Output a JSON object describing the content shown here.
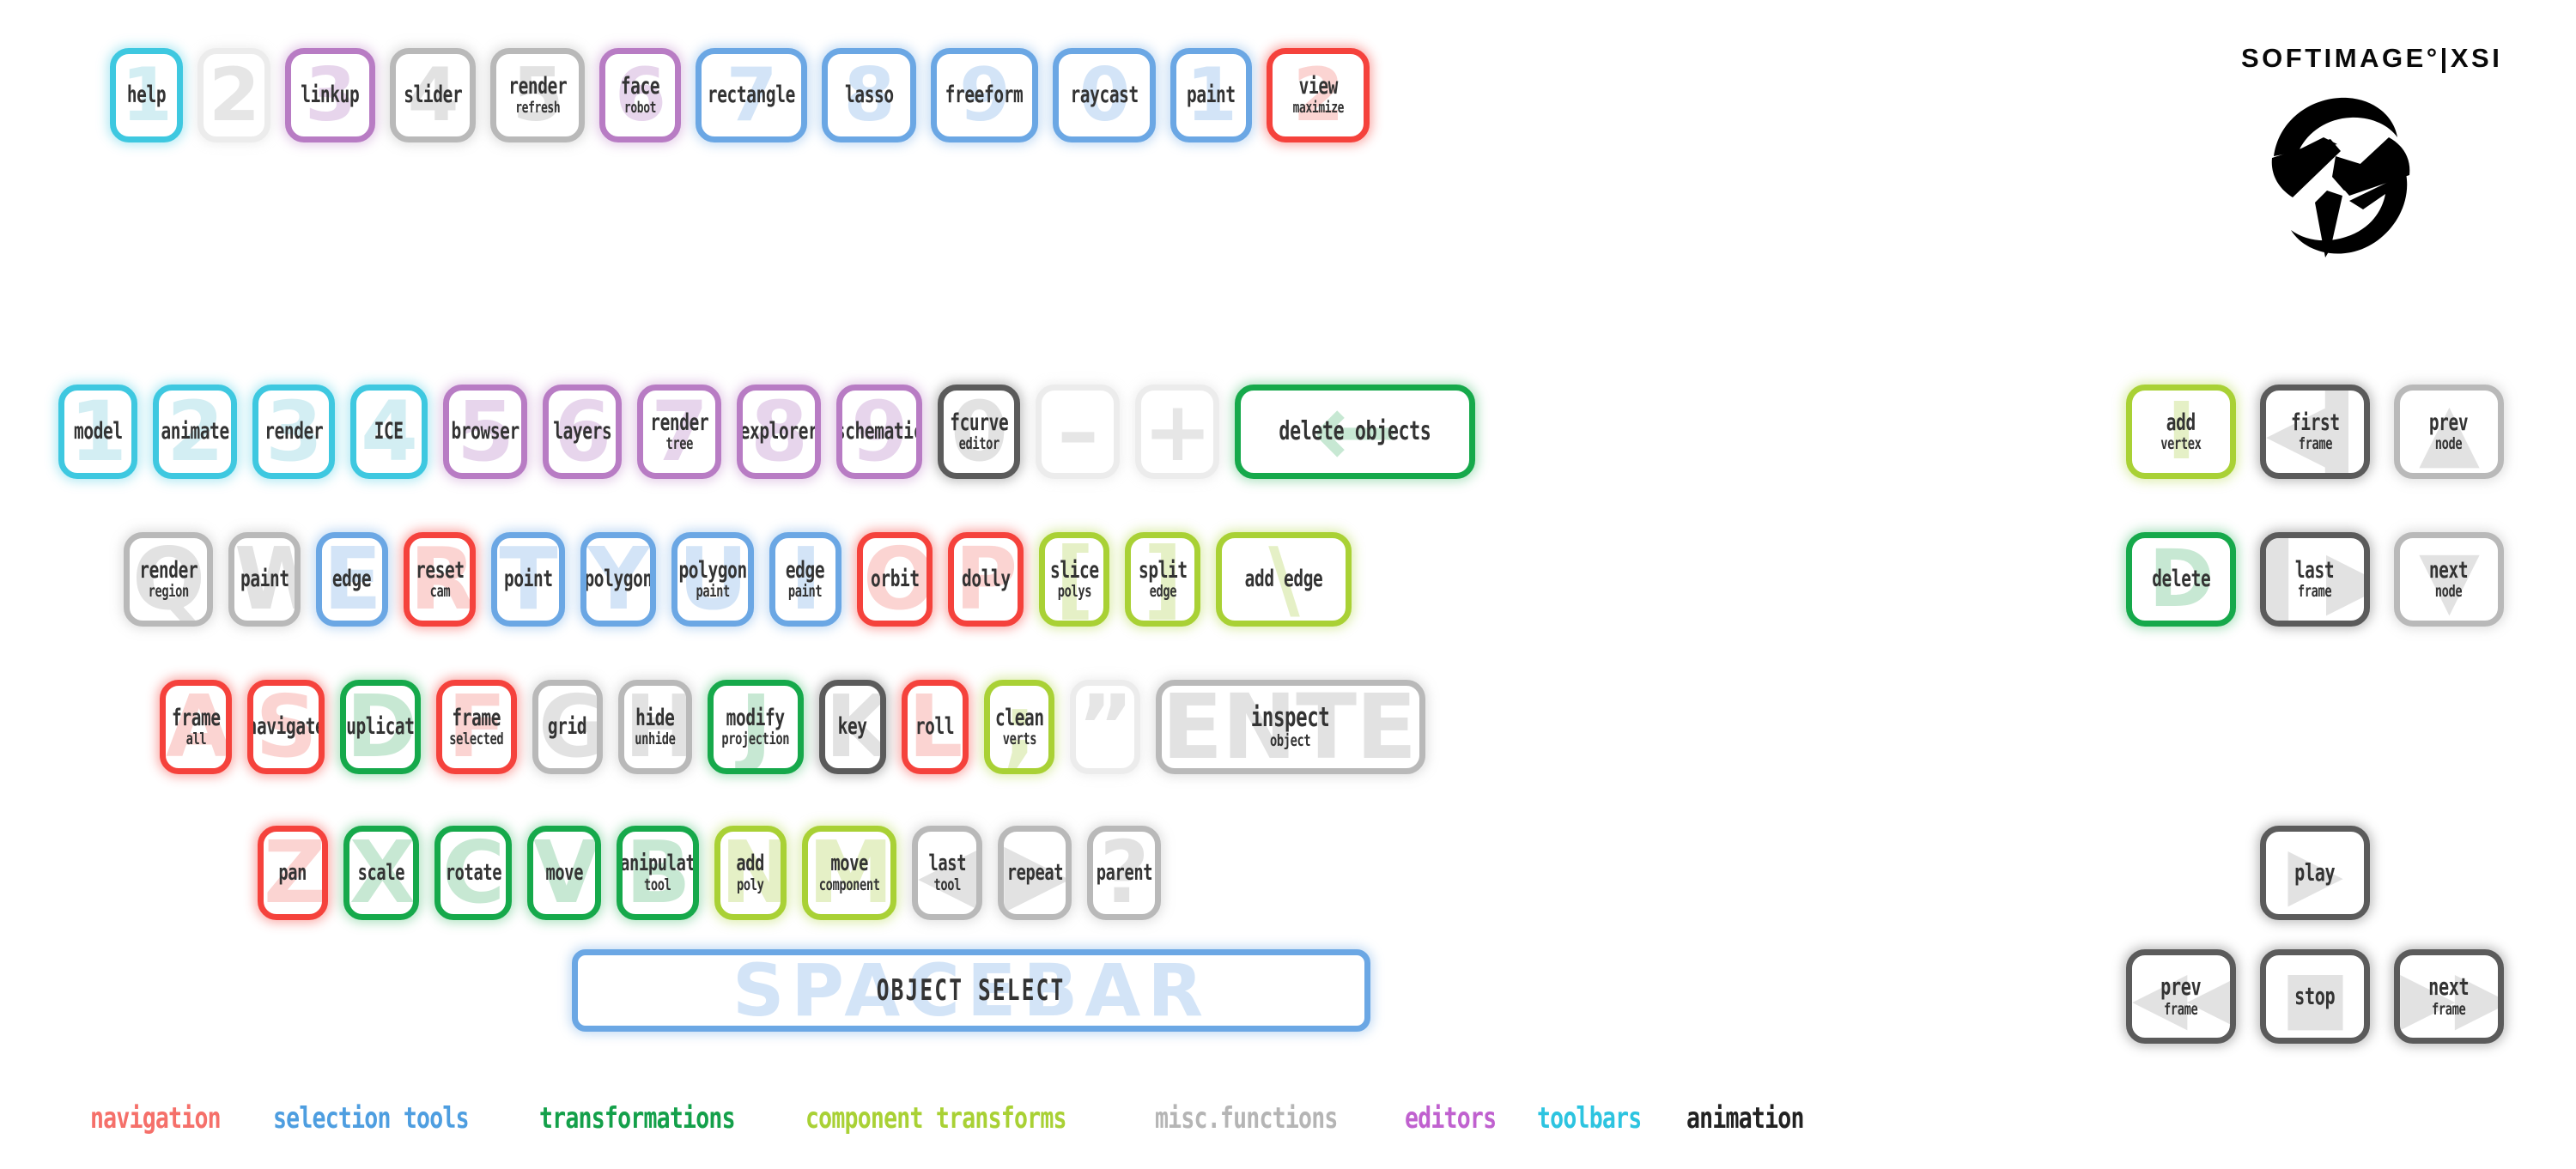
{
  "brand": {
    "wordmark": "SOFTIMAGE°|XSI",
    "mark_name": "softimage-swirl-logo"
  },
  "legend": {
    "items": [
      {
        "label": "navigation",
        "color": "#f5706a"
      },
      {
        "label": "selection tools",
        "color": "#4e9ee0"
      },
      {
        "label": "transformations",
        "color": "#14a04a"
      },
      {
        "label": "component transforms",
        "color": "#a9d135"
      },
      {
        "label": "misc.functions",
        "color": "#b5b5b5"
      },
      {
        "label": "editors",
        "color": "#c061cf"
      },
      {
        "label": "toolbars",
        "color": "#2dc4e0"
      },
      {
        "label": "animation",
        "color": "#222222"
      }
    ]
  },
  "rows": {
    "function_row": [
      {
        "key": "1",
        "main": "help",
        "sub": "",
        "color": "cyan"
      },
      {
        "key": "2",
        "main": "",
        "sub": "",
        "color": "pale"
      },
      {
        "key": "3",
        "main": "linkup",
        "sub": "",
        "color": "purple"
      },
      {
        "key": "4",
        "main": "slider",
        "sub": "",
        "color": "gray"
      },
      {
        "key": "5",
        "main": "render",
        "sub": "refresh",
        "color": "gray"
      },
      {
        "key": "6",
        "main": "face",
        "sub": "robot",
        "color": "purple"
      },
      {
        "key": "7",
        "main": "rectangle",
        "sub": "",
        "color": "blue"
      },
      {
        "key": "8",
        "main": "lasso",
        "sub": "",
        "color": "blue"
      },
      {
        "key": "9",
        "main": "freeform",
        "sub": "",
        "color": "blue"
      },
      {
        "key": "0",
        "main": "raycast",
        "sub": "",
        "color": "blue"
      },
      {
        "key": "1",
        "main": "paint",
        "sub": "",
        "color": "blue"
      },
      {
        "key": "2",
        "main": "view",
        "sub": "maximize",
        "color": "red"
      }
    ],
    "number_row": [
      {
        "key": "1",
        "main": "model",
        "sub": "",
        "color": "cyan"
      },
      {
        "key": "2",
        "main": "animate",
        "sub": "",
        "color": "cyan"
      },
      {
        "key": "3",
        "main": "render",
        "sub": "",
        "color": "cyan"
      },
      {
        "key": "4",
        "main": "ICE",
        "sub": "",
        "color": "cyan"
      },
      {
        "key": "5",
        "main": "browser",
        "sub": "",
        "color": "purple"
      },
      {
        "key": "6",
        "main": "layers",
        "sub": "",
        "color": "purple"
      },
      {
        "key": "7",
        "main": "render",
        "sub": "tree",
        "color": "purple"
      },
      {
        "key": "8",
        "main": "explorer",
        "sub": "",
        "color": "purple"
      },
      {
        "key": "9",
        "main": "schematic",
        "sub": "",
        "color": "purple"
      },
      {
        "key": "0",
        "main": "fcurve",
        "sub": "editor",
        "color": "dark"
      },
      {
        "key": "–",
        "main": "",
        "sub": "",
        "color": "pale"
      },
      {
        "key": "+",
        "main": "",
        "sub": "",
        "color": "pale"
      },
      {
        "key": "←",
        "main": "delete objects",
        "sub": "",
        "color": "green"
      }
    ],
    "qwerty_row": [
      {
        "key": "Q",
        "main": "render",
        "sub": "region",
        "color": "gray"
      },
      {
        "key": "W",
        "main": "paint",
        "sub": "",
        "color": "gray"
      },
      {
        "key": "E",
        "main": "edge",
        "sub": "",
        "color": "blue"
      },
      {
        "key": "R",
        "main": "reset",
        "sub": "cam",
        "color": "red"
      },
      {
        "key": "T",
        "main": "point",
        "sub": "",
        "color": "blue"
      },
      {
        "key": "Y",
        "main": "polygon",
        "sub": "",
        "color": "blue"
      },
      {
        "key": "U",
        "main": "polygon",
        "sub": "paint",
        "color": "blue"
      },
      {
        "key": "I",
        "main": "edge",
        "sub": "paint",
        "color": "blue"
      },
      {
        "key": "O",
        "main": "orbit",
        "sub": "",
        "color": "red"
      },
      {
        "key": "P",
        "main": "dolly",
        "sub": "",
        "color": "red"
      },
      {
        "key": "[",
        "main": "slice",
        "sub": "polys",
        "color": "lime"
      },
      {
        "key": "]",
        "main": "split",
        "sub": "edge",
        "color": "lime"
      },
      {
        "key": "\\",
        "main": "add edge",
        "sub": "",
        "color": "lime"
      }
    ],
    "asdf_row": [
      {
        "key": "A",
        "main": "frame",
        "sub": "all",
        "color": "red"
      },
      {
        "key": "S",
        "main": "navigate",
        "sub": "",
        "color": "red"
      },
      {
        "key": "D",
        "main": "duplicate",
        "sub": "",
        "color": "green"
      },
      {
        "key": "F",
        "main": "frame",
        "sub": "selected",
        "color": "red"
      },
      {
        "key": "G",
        "main": "grid",
        "sub": "",
        "color": "gray"
      },
      {
        "key": "H",
        "main": "hide",
        "sub": "unhide",
        "color": "gray"
      },
      {
        "key": "J",
        "main": "modify",
        "sub": "projection",
        "color": "green"
      },
      {
        "key": "K",
        "main": "key",
        "sub": "",
        "color": "dark"
      },
      {
        "key": "L",
        "main": "roll",
        "sub": "",
        "color": "red"
      },
      {
        "key": ";",
        "main": "clean",
        "sub": "verts",
        "color": "lime"
      },
      {
        "key": "”",
        "main": "",
        "sub": "",
        "color": "pale"
      },
      {
        "key": "ENTER",
        "main": "inspect",
        "sub": "object",
        "color": "gray"
      }
    ],
    "zxcv_row": [
      {
        "key": "Z",
        "main": "pan",
        "sub": "",
        "color": "red"
      },
      {
        "key": "X",
        "main": "scale",
        "sub": "",
        "color": "green"
      },
      {
        "key": "C",
        "main": "rotate",
        "sub": "",
        "color": "green"
      },
      {
        "key": "V",
        "main": "move",
        "sub": "",
        "color": "green"
      },
      {
        "key": "B",
        "main": "manipulate",
        "sub": "tool",
        "color": "green"
      },
      {
        "key": "N",
        "main": "add",
        "sub": "poly",
        "color": "lime"
      },
      {
        "key": "M",
        "main": "move",
        "sub": "component",
        "color": "lime"
      },
      {
        "key": "◀",
        "main": "last",
        "sub": "tool",
        "color": "gray"
      },
      {
        "key": "▶",
        "main": "repeat",
        "sub": "",
        "color": "gray"
      },
      {
        "key": "?",
        "main": "parent",
        "sub": "",
        "color": "gray"
      }
    ],
    "spacebar": {
      "key": "SPACEBAR",
      "main": "OBJECT SELECT",
      "sub": "",
      "color": "blue"
    }
  },
  "nav_cluster": [
    {
      "key": "I",
      "main": "add",
      "sub": "vertex",
      "color": "lime"
    },
    {
      "key": "◀▍",
      "main": "first",
      "sub": "frame",
      "color": "dark"
    },
    {
      "key": "▲",
      "main": "prev",
      "sub": "node",
      "color": "gray"
    },
    {
      "key": "D",
      "main": "delete",
      "sub": "",
      "color": "green"
    },
    {
      "key": "▍▶",
      "main": "last",
      "sub": "frame",
      "color": "dark"
    },
    {
      "key": "▼",
      "main": "next",
      "sub": "node",
      "color": "gray"
    }
  ],
  "arrow_cluster": [
    {
      "key": "▶",
      "main": "play",
      "sub": "",
      "color": "dark"
    },
    {
      "key": "◀◀",
      "main": "prev",
      "sub": "frame",
      "color": "dark"
    },
    {
      "key": "■",
      "main": "stop",
      "sub": "",
      "color": "dark"
    },
    {
      "key": "▶▶",
      "main": "next",
      "sub": "frame",
      "color": "dark"
    }
  ]
}
